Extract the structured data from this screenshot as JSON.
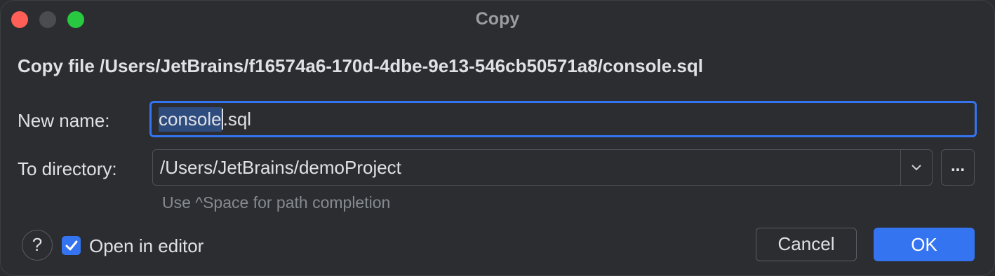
{
  "window": {
    "title": "Copy",
    "heading": "Copy file /Users/JetBrains/f16574a6-170d-4dbe-9e13-546cb50571a8/console.sql"
  },
  "form": {
    "new_name_label": "New name:",
    "new_name_selected": "console",
    "new_name_rest": ".sql",
    "to_directory_label": "To directory:",
    "to_directory_value": "/Users/JetBrains/demoProject",
    "browse_label": "...",
    "hint": "Use ^Space for path completion"
  },
  "footer": {
    "help_label": "?",
    "open_in_editor_label": "Open in editor",
    "open_in_editor_checked": true,
    "cancel_label": "Cancel",
    "ok_label": "OK"
  },
  "colors": {
    "background": "#2b2d30",
    "accent": "#3574f0",
    "selection": "#2f4c7e",
    "text": "#dfe1e5",
    "hint": "#868a91"
  },
  "icons": {
    "close": "close-traffic-light-icon",
    "minimize": "minimize-traffic-light-icon",
    "maximize": "maximize-traffic-light-icon",
    "dropdown": "chevron-down-icon",
    "check": "checkmark-icon"
  }
}
